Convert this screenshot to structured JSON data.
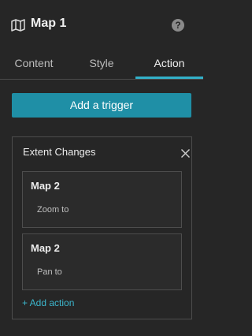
{
  "header": {
    "title": "Map 1",
    "map_icon": "map-icon",
    "help_icon": "help-icon",
    "help_glyph": "?"
  },
  "tabs": [
    {
      "label": "Content",
      "active": false
    },
    {
      "label": "Style",
      "active": false
    },
    {
      "label": "Action",
      "active": true
    }
  ],
  "add_trigger_label": "Add a trigger",
  "trigger": {
    "name": "Extent Changes",
    "close_icon": "close-icon",
    "actions": [
      {
        "target": "Map 2",
        "operation": "Zoom to"
      },
      {
        "target": "Map 2",
        "operation": "Pan to"
      }
    ],
    "add_action_label": "+ Add action"
  },
  "colors": {
    "background": "#262626",
    "accent": "#33b0c8",
    "button": "#1f8fa6",
    "border": "#4d4d4d"
  }
}
